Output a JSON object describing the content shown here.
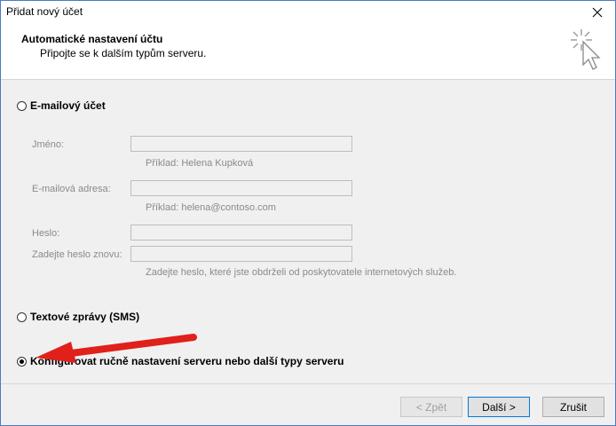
{
  "window": {
    "title": "Přidat nový účet"
  },
  "header": {
    "title": "Automatické nastavení účtu",
    "subtitle": "Připojte se k dalším typům serveru."
  },
  "options": {
    "email_account": {
      "label": "E-mailový účet",
      "selected": false
    },
    "sms": {
      "label": "Textové zprávy (SMS)",
      "selected": false
    },
    "manual": {
      "label": "Konfigurovat ručně nastavení serveru nebo další typy serveru",
      "selected": true
    }
  },
  "fields": {
    "name": {
      "label": "Jméno:",
      "value": "",
      "hint": "Příklad: Helena Kupková"
    },
    "email": {
      "label": "E-mailová adresa:",
      "value": "",
      "hint": "Příklad: helena@contoso.com"
    },
    "password": {
      "label": "Heslo:",
      "value": ""
    },
    "password_repeat": {
      "label": "Zadejte heslo znovu:",
      "value": ""
    },
    "password_hint": "Zadejte heslo, které jste obdrželi od poskytovatele internetových služeb."
  },
  "buttons": {
    "back": "< Zpět",
    "next": "Další >",
    "cancel": "Zrušit"
  },
  "colors": {
    "window_border": "#4a7ac8",
    "annotation_arrow": "#e0201a",
    "default_button_border": "#0078d7"
  }
}
